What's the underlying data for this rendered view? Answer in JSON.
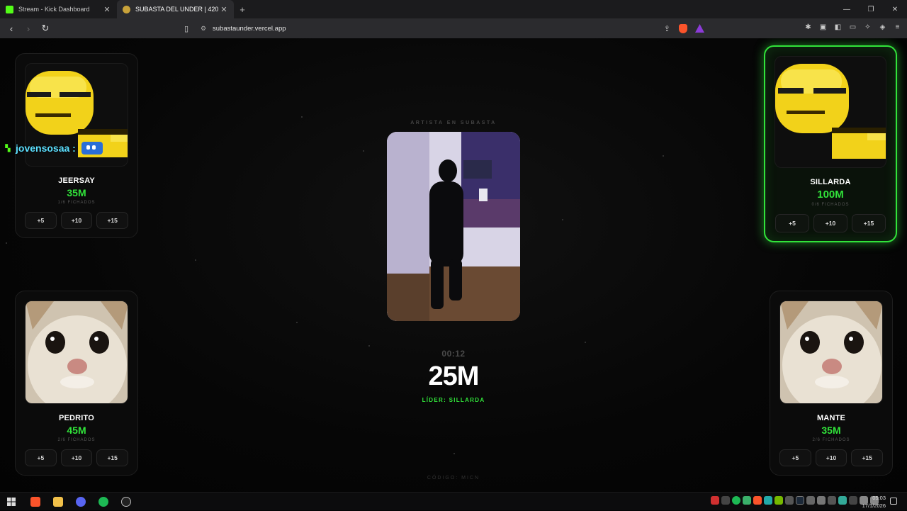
{
  "browser": {
    "tabs": [
      {
        "title": "Stream - Kick Dashboard",
        "active": false,
        "favicon_color": "#53fc18"
      },
      {
        "title": "SUBASTA DEL UNDER | 420",
        "active": true,
        "favicon_color": "#c8a23a"
      }
    ],
    "new_tab_label": "+",
    "url": "subastaunder.vercel.app"
  },
  "overlay": {
    "chat_username": "jovensosaa :"
  },
  "center": {
    "label": "ARTISTA EN SUBASTA",
    "timer": "00:12",
    "current_bid": "25M",
    "leader_text": "LÍDER: SILLARDA",
    "code_text": "CÓDIGO: MICN"
  },
  "players": {
    "top_left": {
      "name": "JEERSAY",
      "bid": "35M",
      "signed": "1/6 FICHADOS",
      "avatar": "pixel-smug-face",
      "buttons": [
        "+5",
        "+10",
        "+15"
      ]
    },
    "top_right": {
      "name": "SILLARDA",
      "bid": "100M",
      "signed": "0/6 FICHADOS",
      "avatar": "pixel-smug-face",
      "buttons": [
        "+5",
        "+10",
        "+15"
      ]
    },
    "bottom_left": {
      "name": "PEDRITO",
      "bid": "45M",
      "signed": "2/6 FICHADOS",
      "avatar": "cat-photo",
      "buttons": [
        "+5",
        "+10",
        "+15"
      ]
    },
    "bottom_right": {
      "name": "MANTE",
      "bid": "35M",
      "signed": "2/6 FICHADOS",
      "avatar": "cat-photo",
      "buttons": [
        "+5",
        "+10",
        "+15"
      ]
    }
  },
  "colors": {
    "accent_green": "#31e33a",
    "background": "#050505",
    "chat_name": "#5ce0ff"
  },
  "taskbar": {
    "time": "05:03",
    "date": "17/1/2026"
  }
}
